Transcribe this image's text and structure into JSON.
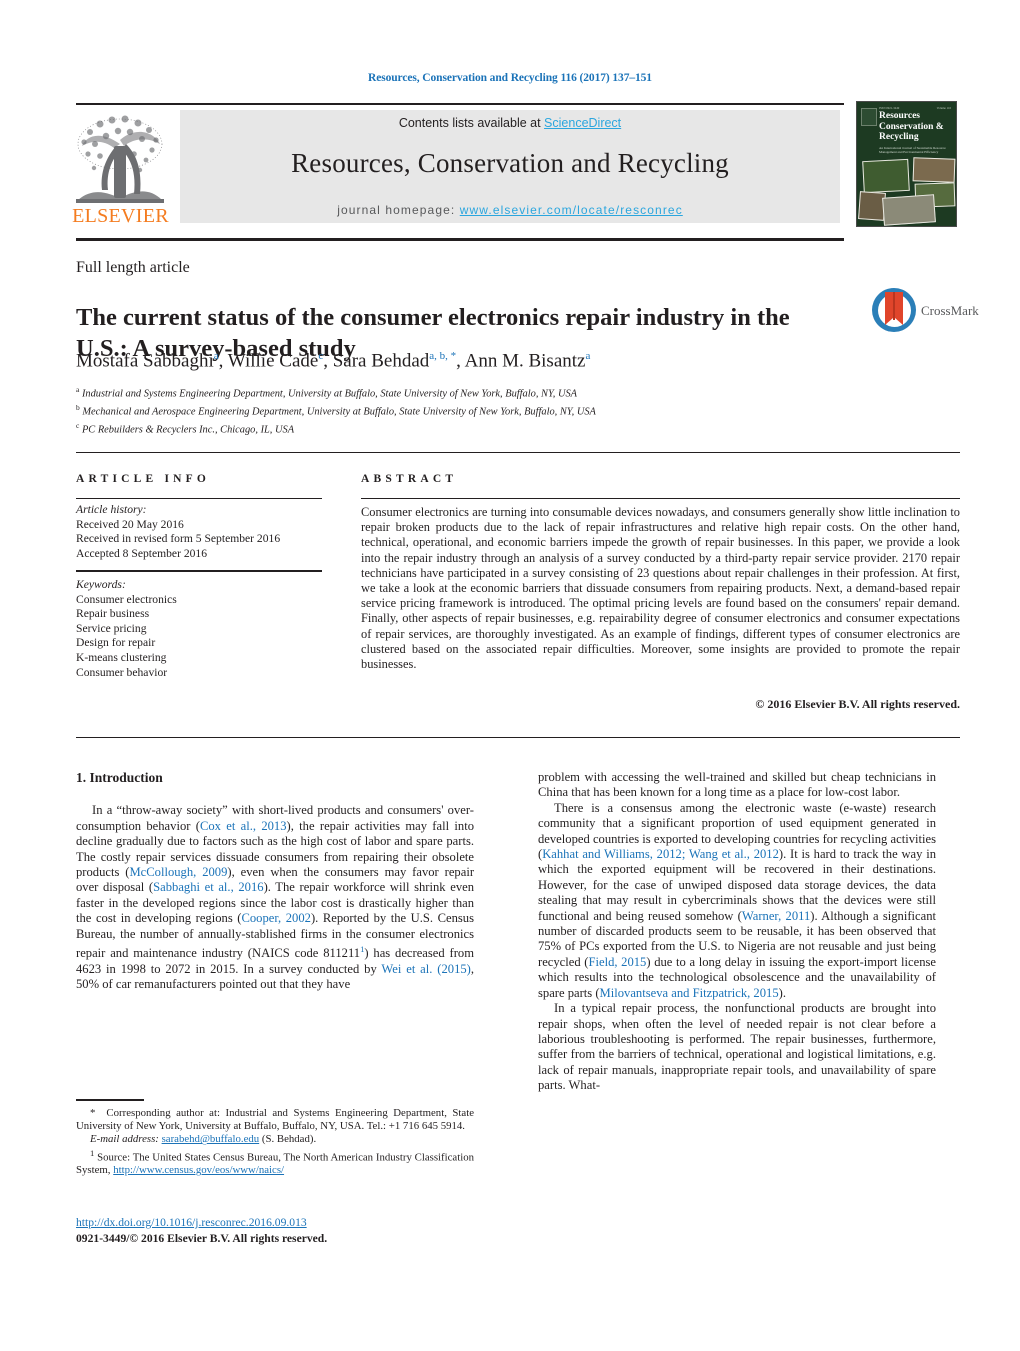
{
  "running_head": "Resources, Conservation and Recycling 116 (2017) 137–151",
  "journal_header": {
    "contents_prefix": "Contents lists available at ",
    "sciencedirect": "ScienceDirect",
    "journal_title": "Resources, Conservation and Recycling",
    "homepage_label": "journal homepage: ",
    "homepage_url": "www.elsevier.com/locate/resconrec",
    "publisher_logo_text": "ELSEVIER",
    "cover": {
      "line1": "Resources",
      "line2": "Conservation &",
      "line3": "Recycling",
      "subtitle": "An International Journal of Sustainable Resource Management and Environmental Efficiency",
      "top_left": "ISSN 0921-3449",
      "top_right": "Volume 116"
    },
    "band_color": "#e7e7e7",
    "link_color": "#2ba6de"
  },
  "article": {
    "type": "Full length article",
    "title": "The current status of the consumer electronics repair industry in the U.S.: A survey-based study",
    "crossmark_label": "CrossMark",
    "authors": [
      {
        "name": "Mostafa Sabbaghi",
        "marks": "a"
      },
      {
        "name": "Willie Cade",
        "marks": "c"
      },
      {
        "name": "Sara Behdad",
        "marks": "a, b, *"
      },
      {
        "name": "Ann M. Bisantz",
        "marks": "a"
      }
    ],
    "affiliations": [
      {
        "mark": "a",
        "text": "Industrial and Systems Engineering Department, University at Buffalo, State University of New York, Buffalo, NY, USA"
      },
      {
        "mark": "b",
        "text": "Mechanical and Aerospace Engineering Department, University at Buffalo, State University of New York, Buffalo, NY, USA"
      },
      {
        "mark": "c",
        "text": "PC Rebuilders & Recyclers Inc., Chicago, IL, USA"
      }
    ]
  },
  "article_info": {
    "heading": "ARTICLE INFO",
    "history_label": "Article history:",
    "history": [
      "Received 20 May 2016",
      "Received in revised form 5 September 2016",
      "Accepted 8 September 2016"
    ],
    "keywords_label": "Keywords:",
    "keywords": [
      "Consumer electronics",
      "Repair business",
      "Service pricing",
      "Design for repair",
      "K-means clustering",
      "Consumer behavior"
    ]
  },
  "abstract": {
    "heading": "ABSTRACT",
    "text": "Consumer electronics are turning into consumable devices nowadays, and consumers generally show little inclination to repair broken products due to the lack of repair infrastructures and relative high repair costs. On the other hand, technical, operational, and economic barriers impede the growth of repair businesses. In this paper, we provide a look into the repair industry through an analysis of a survey conducted by a third-party repair service provider. 2170 repair technicians have participated in a survey consisting of 23 questions about repair challenges in their profession. At first, we take a look at the economic barriers that dissuade consumers from repairing products. Next, a demand-based repair service pricing framework is introduced. The optimal pricing levels are found based on the consumers' repair demand. Finally, other aspects of repair businesses, e.g. repairability degree of consumer electronics and consumer expectations of repair services, are thoroughly investigated. As an example of findings, different types of consumer electronics are clustered based on the associated repair difficulties. Moreover, some insights are provided to promote the repair businesses.",
    "copyright": "© 2016 Elsevier B.V. All rights reserved."
  },
  "body": {
    "section_heading": "1. Introduction",
    "left_column": {
      "p1_part1": "In a “throw-away society” with short-lived products and consumers' over-consumption behavior (",
      "p1_ref1": "Cox et al., 2013",
      "p1_part2": "), the repair activities may fall into decline gradually due to factors such as the high cost of labor and spare parts. The costly repair services dissuade consumers from repairing their obsolete products (",
      "p1_ref2": "McCollough, 2009",
      "p1_part3": "), even when the consumers may favor repair over disposal (",
      "p1_ref3": "Sabbaghi et al., 2016",
      "p1_part4": "). The repair workforce will shrink even faster in the developed regions since the labor cost is drastically higher than the cost in developing regions (",
      "p1_ref4": "Cooper, 2002",
      "p1_part5": "). Reported by the U.S. Census Bureau, the number of annually-stablished firms in the consumer electronics repair and maintenance industry (NAICS code 811211",
      "p1_footnote_mark": "1",
      "p1_part6": ") has decreased from 4623 in 1998 to 2072 in 2015. In a survey conducted by ",
      "p1_ref5": "Wei et al. (2015)",
      "p1_part7": ", 50% of car remanufacturers pointed out that they have"
    },
    "right_column": {
      "p0": "problem with accessing the well-trained and skilled but cheap technicians in China that has been known for a long time as a place for low-cost labor.",
      "p1_part1": "There is a consensus among the electronic waste (e-waste) research community that a significant proportion of used equipment generated in developed countries is exported to developing countries for recycling activities (",
      "p1_ref1": "Kahhat and Williams, 2012; Wang et al., 2012",
      "p1_part2": "). It is hard to track the way in which the exported equipment will be recovered in their destinations. However, for the case of unwiped disposed data storage devices, the data stealing that may result in cybercriminals shows that the devices were still functional and being reused somehow (",
      "p1_ref2": "Warner, 2011",
      "p1_part3": "). Although a significant number of discarded products seem to be reusable, it has been observed that 75% of PCs exported from the U.S. to Nigeria are not reusable and just being recycled (",
      "p1_ref3": "Field, 2015",
      "p1_part4": ") due to a long delay in issuing the export-import license which results into the technological obsolescence and the unavailability of spare parts (",
      "p1_ref4": "Milovantseva and Fitzpatrick, 2015",
      "p1_part5": ").",
      "p2": "In a typical repair process, the nonfunctional products are brought into repair shops, when often the level of needed repair is not clear before a laborious troubleshooting is performed. The repair businesses, furthermore, suffer from the barriers of technical, operational and logistical limitations, e.g. lack of repair manuals, inappropriate repair tools, and unavailability of spare parts. What-"
    }
  },
  "footnotes": {
    "corresponding_mark": "*",
    "corresponding_text": "Corresponding author at: Industrial and Systems Engineering Department, State University of New York, University at Buffalo, Buffalo, NY, USA. Tel.: +1 716 645 5914.",
    "email_label": "E-mail address:",
    "email": "sarabehd@buffalo.edu",
    "email_owner": "(S. Behdad).",
    "source_mark": "1",
    "source_text": "Source: The United States Census Bureau, The North American Industry Classification System, ",
    "source_url": "http://www.census.gov/eos/www/naics/"
  },
  "footer": {
    "doi": "http://dx.doi.org/10.1016/j.resconrec.2016.09.013",
    "issn": "0921-3449/© 2016 Elsevier B.V. All rights reserved."
  }
}
